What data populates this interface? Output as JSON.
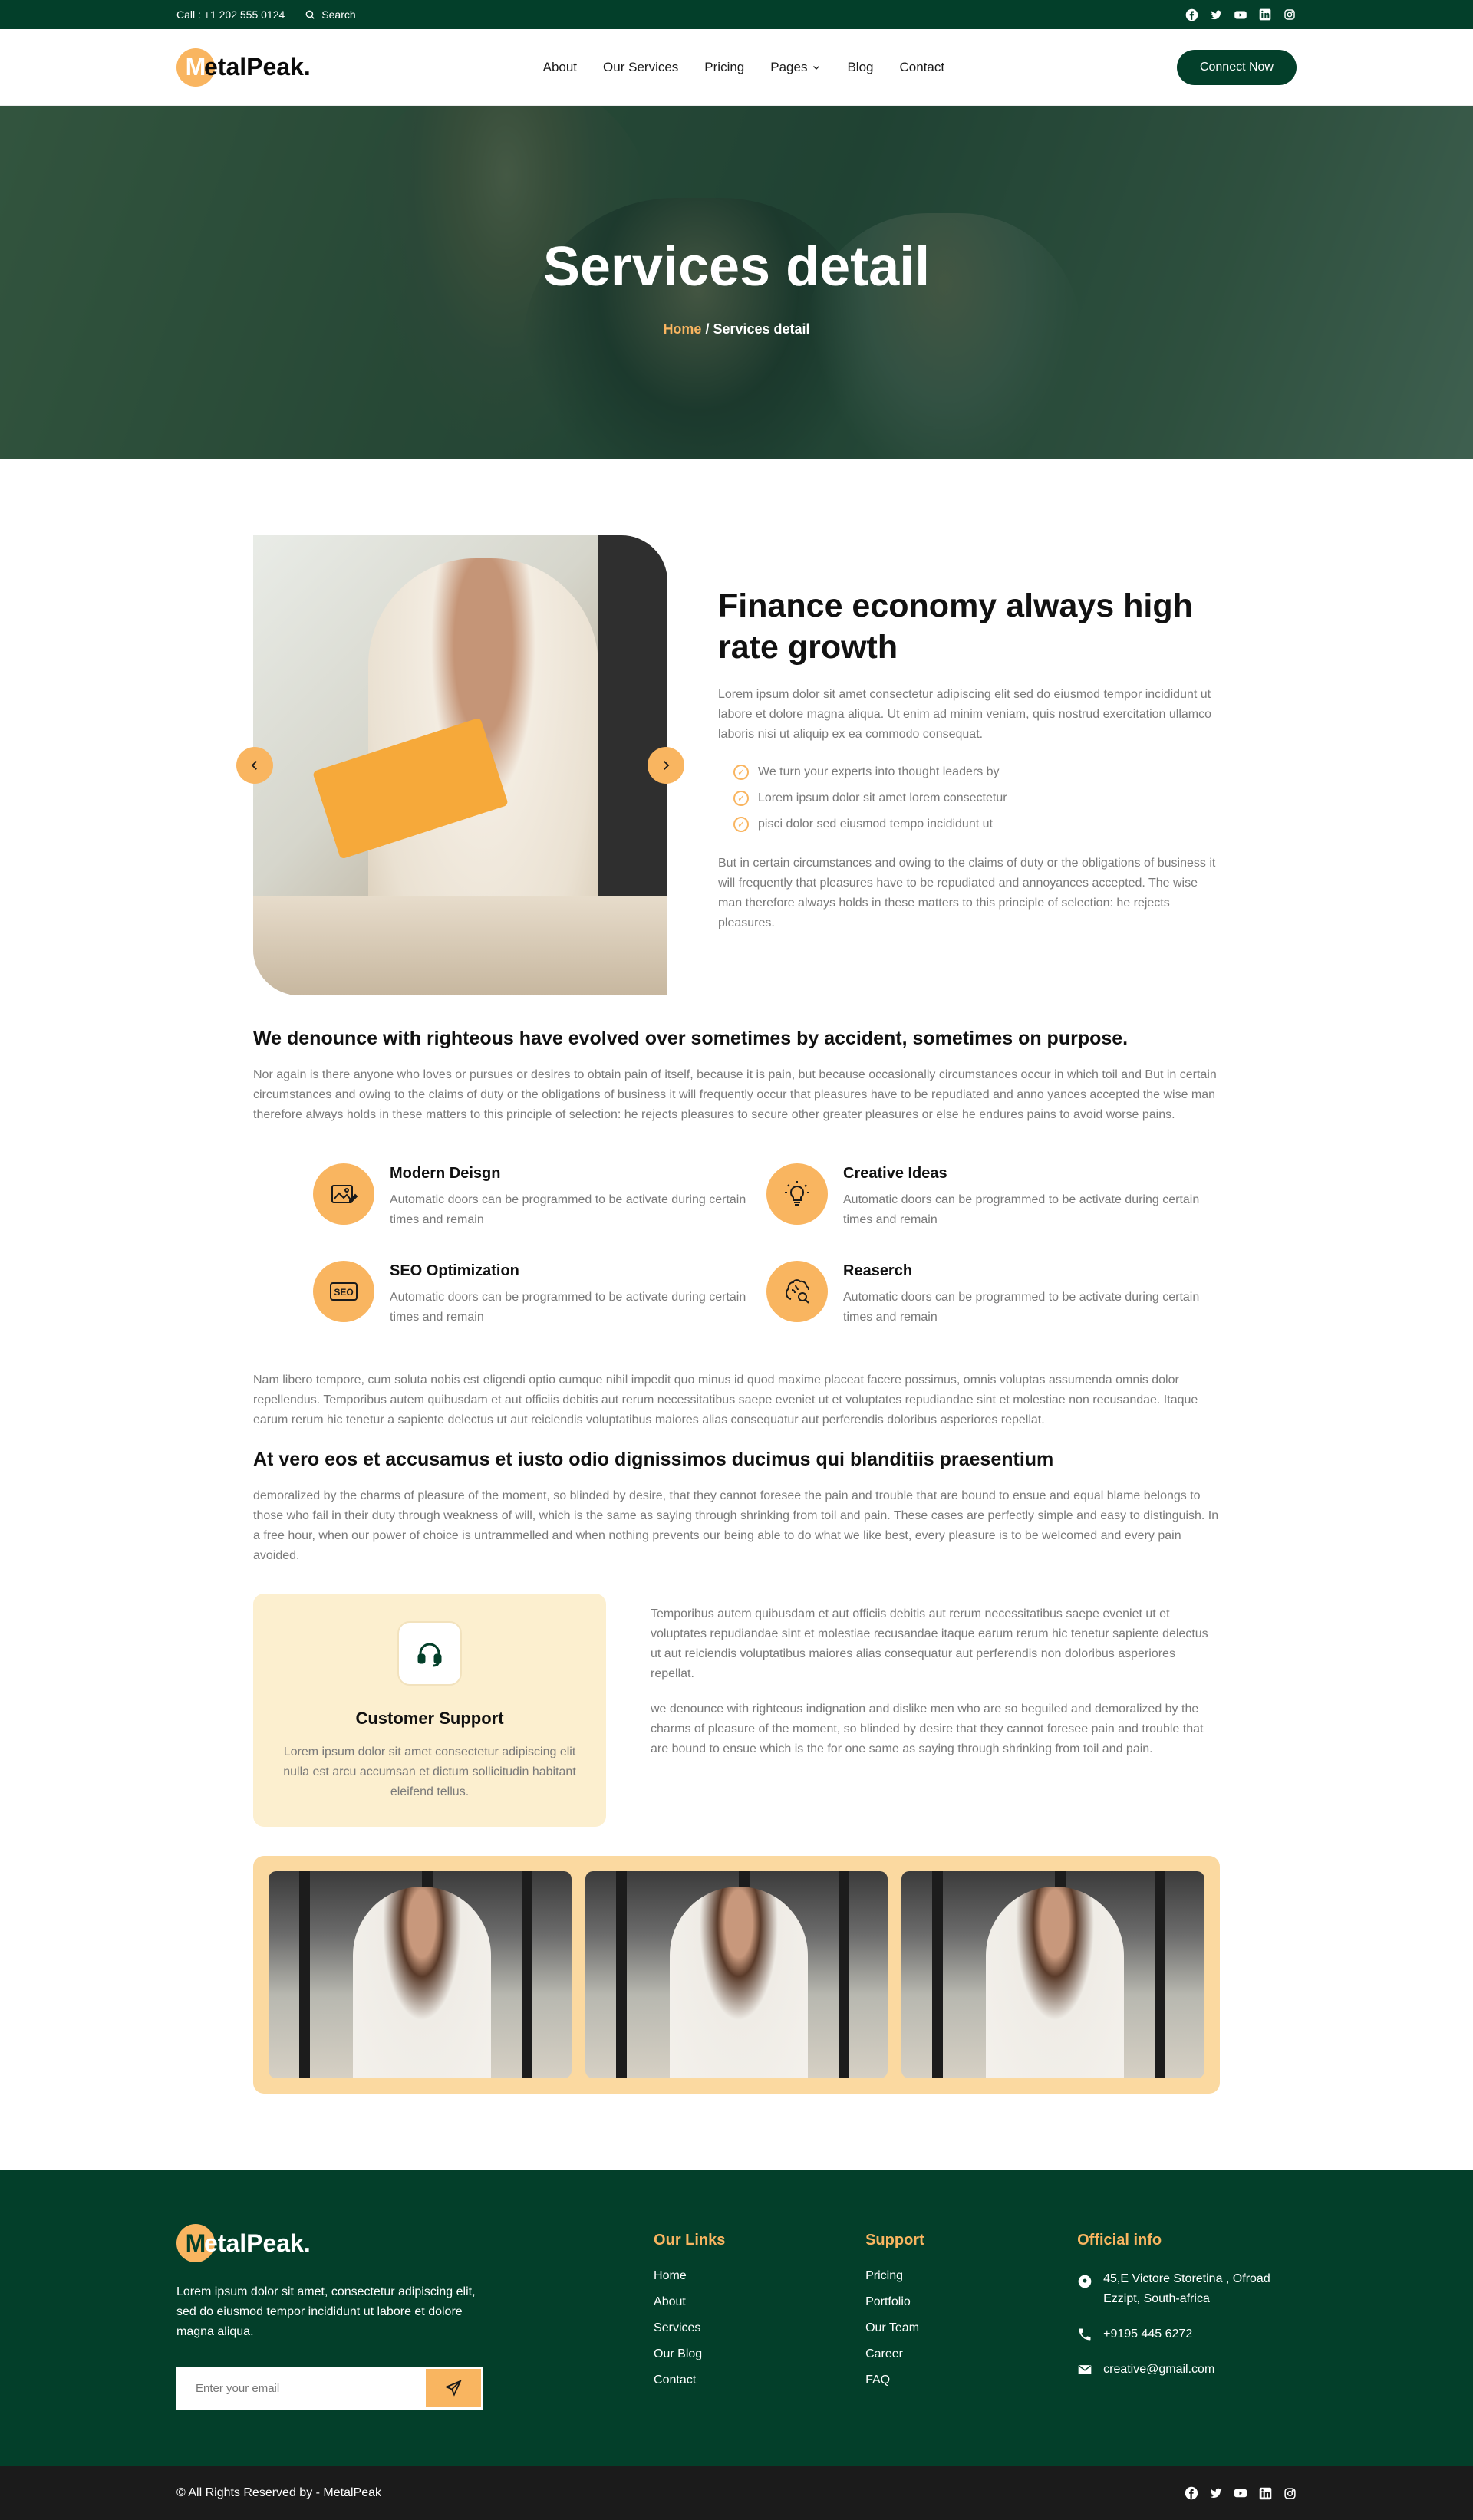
{
  "topbar": {
    "phone": "Call : +1 202 555 0124",
    "search_label": "Search"
  },
  "nav": {
    "brand_initial": "M",
    "brand_rest": "etalPeak.",
    "items": [
      {
        "label": "About"
      },
      {
        "label": "Our Services"
      },
      {
        "label": "Pricing"
      },
      {
        "label": "Pages"
      },
      {
        "label": "Blog"
      },
      {
        "label": "Contact"
      }
    ],
    "cta": "Connect Now"
  },
  "hero": {
    "title": "Services detail",
    "crumb_home": "Home",
    "crumb_sep": " / ",
    "crumb_current": "Services detail"
  },
  "intro": {
    "heading": "Finance economy always high rate growth",
    "paragraph1": "Lorem ipsum dolor sit amet consectetur adipiscing elit sed do eiusmod tempor incididunt ut labore et dolore magna aliqua. Ut enim ad minim veniam, quis nostrud exercitation ullamco laboris nisi ut aliquip ex ea commodo consequat.",
    "checks": [
      "We turn your experts into thought leaders by",
      "Lorem ipsum dolor sit amet lorem consectetur",
      "pisci dolor sed eiusmod tempo incididunt ut"
    ],
    "paragraph2": "But in certain circumstances and owing to the claims of duty or the obligations of business it will frequently that pleasures have to be repudiated and annoyances accepted. The wise man therefore always holds in these matters to this principle of selection: he rejects pleasures."
  },
  "section1": {
    "heading": "We denounce with righteous have evolved over sometimes by accident, sometimes on purpose.",
    "paragraph": "Nor again is there anyone who loves or pursues or desires to obtain pain of itself, because it is pain, but because occasionally circumstances occur in which toil and But in certain circumstances and owing to the claims of duty or the obligations of business it will frequently occur that pleasures have to be repudiated and anno yances accepted the wise man therefore always holds in these matters to this principle of selection: he rejects pleasures to secure other greater pleasures or else he endures pains to avoid worse pains."
  },
  "features": [
    {
      "title": "Modern Deisgn",
      "text": "Automatic doors can be programmed to be activate during certain times and remain",
      "icon": "image-edit-icon"
    },
    {
      "title": "Creative Ideas",
      "text": "Automatic doors can be programmed to be activate during certain times and remain",
      "icon": "lightbulb-icon"
    },
    {
      "title": "SEO Optimization",
      "text": "Automatic doors can be programmed to be activate during certain times and remain",
      "icon": "seo-icon"
    },
    {
      "title": "Reaserch",
      "text": "Automatic doors can be programmed to be activate during certain times and remain",
      "icon": "brain-search-icon"
    }
  ],
  "section2": {
    "paragraph": "Nam libero tempore, cum soluta nobis est eligendi optio cumque nihil impedit quo minus id quod maxime placeat facere possimus, omnis voluptas assumenda omnis dolor repellendus. Temporibus autem quibusdam et aut officiis debitis aut rerum necessitatibus saepe eveniet ut et voluptates repudiandae sint et molestiae non recusandae. Itaque earum rerum hic tenetur a sapiente delectus ut aut reiciendis voluptatibus maiores alias consequatur aut perferendis doloribus asperiores repellat."
  },
  "section3": {
    "heading": "At vero eos et accusamus et iusto odio dignissimos ducimus qui blanditiis praesentium",
    "paragraph": "demoralized by the charms of pleasure of the moment, so blinded by desire, that they cannot foresee the pain and trouble that are bound to ensue and equal blame belongs to those who fail in their duty through weakness of will, which is the same as saying through shrinking from toil and pain. These cases are perfectly simple and easy to distinguish. In a free hour, when our power of choice is untrammelled and when nothing prevents our being able to do what we like best, every pleasure is to be welcomed and every pain avoided."
  },
  "support": {
    "title": "Customer Support",
    "text": "Lorem ipsum dolor sit amet consectetur adipiscing elit nulla est arcu accumsan et dictum sollicitudin habitant eleifend tellus.",
    "paragraph1": "Temporibus autem quibusdam et aut officiis debitis aut rerum necessitatibus saepe eveniet ut et voluptates repudiandae sint et molestiae recusandae itaque earum rerum hic tenetur sapiente delectus ut aut reiciendis voluptatibus maiores alias consequatur aut perferendis non doloribus asperiores repellat.",
    "paragraph2": "we denounce with righteous indignation and dislike men who are so beguiled and demoralized by the charms of pleasure of the moment, so blinded by desire that they cannot foresee pain and trouble that are bound to ensue which is the for one same as saying through shrinking from toil and pain."
  },
  "footer": {
    "brand_initial": "M",
    "brand_rest": "etalPeak.",
    "description": "Lorem ipsum dolor sit amet, consectetur adipiscing elit, sed do eiusmod tempor incididunt ut labore et dolore magna aliqua.",
    "email_placeholder": "Enter your email",
    "links_title": "Our Links",
    "links": [
      "Home",
      "About",
      "Services",
      "Our Blog",
      "Contact"
    ],
    "support_title": "Support",
    "support_links": [
      "Pricing",
      "Portfolio",
      "Our Team",
      "Career",
      "FAQ"
    ],
    "info_title": "Official info",
    "address": "45,E Victore Storetina , Ofroad Ezzipt, South-africa",
    "phone": "+9195 445 6272",
    "email": "creative@gmail.com"
  },
  "bottombar": {
    "copyright": "© All Rights Reserved by - MetalPeak"
  },
  "colors": {
    "primary_green": "#033f2a",
    "accent_orange": "#f9b560",
    "support_bg": "#fcefcf",
    "gallery_bg": "#fbd9a0"
  }
}
